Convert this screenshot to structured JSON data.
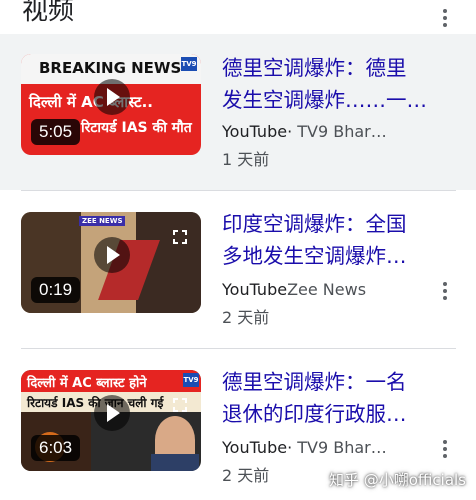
{
  "section": {
    "title": "视频"
  },
  "videos": [
    {
      "title_lines": [
        "德里空调爆炸：德里",
        "发生空调爆炸……一…"
      ],
      "platform": "YouTube",
      "channel": "TV9 Bhar…",
      "date": "1 天前",
      "duration": "5:05",
      "thumb_banner": "BREAKING NEWS",
      "thumb_line1": "दिल्ली में AC ब्लास्ट..",
      "thumb_line2": "रिटायर्ड IAS की मौत",
      "thumb_logo": "TV9"
    },
    {
      "title_lines": [
        "印度空调爆炸：全国",
        "多地发生空调爆炸…"
      ],
      "platform": "YouTube",
      "channel": "Zee News",
      "date": "2 天前",
      "duration": "0:19",
      "thumb_tag": "ZEE NEWS"
    },
    {
      "title_lines": [
        "德里空调爆炸：一名",
        "退休的印度行政服…"
      ],
      "platform": "YouTube",
      "channel": "TV9 Bhar…",
      "date": "2 天前",
      "duration": "6:03",
      "thumb_line1": "दिल्ली में AC ब्लास्ट होने",
      "thumb_line2": "रिटायर्ड IAS की जान चली गई",
      "thumb_logo": "TV9"
    }
  ],
  "watermark": "知乎 @小嗍officials",
  "colors": {
    "title": "#1a0dab",
    "highlight_bg": "#f1f3f4",
    "breaking_red": "#e52421"
  }
}
